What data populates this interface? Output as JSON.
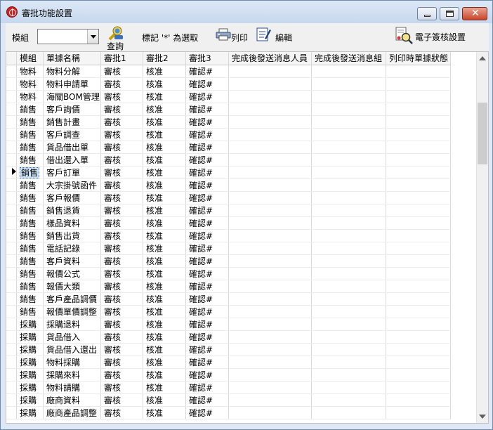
{
  "window": {
    "title": "審批功能設置"
  },
  "toolbar": {
    "module_label": "模組",
    "module_value": "",
    "query_label": "查詢",
    "mark_hint": "標記 '*' 為選取",
    "print_label": "列印",
    "edit_label": "編輯",
    "esign_label": "電子簽核設置"
  },
  "grid": {
    "columns": [
      "模組",
      "單據名稱",
      "審批1",
      "審批2",
      "審批3",
      "完成後發送消息人員",
      "完成後發送消息組",
      "列印時單據狀態"
    ],
    "current_row": 8,
    "rows": [
      [
        "物料",
        "物料分解",
        "審核",
        "核准",
        "確認#",
        "",
        "",
        ""
      ],
      [
        "物料",
        "物料申請單",
        "審核",
        "核准",
        "確認#",
        "",
        "",
        ""
      ],
      [
        "物料",
        "海關BOM管理",
        "審核",
        "核准",
        "確認#",
        "",
        "",
        ""
      ],
      [
        "銷售",
        "客戶詢價",
        "審核",
        "核准",
        "確認#",
        "",
        "",
        ""
      ],
      [
        "銷售",
        "銷售計畫",
        "審核",
        "核准",
        "確認#",
        "",
        "",
        ""
      ],
      [
        "銷售",
        "客戶調查",
        "審核",
        "核准",
        "確認#",
        "",
        "",
        ""
      ],
      [
        "銷售",
        "貨品借出單",
        "審核",
        "核准",
        "確認#",
        "",
        "",
        ""
      ],
      [
        "銷售",
        "借出還入單",
        "審核",
        "核准",
        "確認#",
        "",
        "",
        ""
      ],
      [
        "銷售",
        "客戶訂單",
        "審核",
        "核准",
        "確認#",
        "",
        "",
        ""
      ],
      [
        "銷售",
        "大宗掛號函件",
        "審核",
        "核准",
        "確認#",
        "",
        "",
        ""
      ],
      [
        "銷售",
        "客戶報價",
        "審核",
        "核准",
        "確認#",
        "",
        "",
        ""
      ],
      [
        "銷售",
        "銷售退貨",
        "審核",
        "核准",
        "確認#",
        "",
        "",
        ""
      ],
      [
        "銷售",
        "樣品資料",
        "審核",
        "核准",
        "確認#",
        "",
        "",
        ""
      ],
      [
        "銷售",
        "銷售出貨",
        "審核",
        "核准",
        "確認#",
        "",
        "",
        ""
      ],
      [
        "銷售",
        "電話記錄",
        "審核",
        "核准",
        "確認#",
        "",
        "",
        ""
      ],
      [
        "銷售",
        "客戶資料",
        "審核",
        "核准",
        "確認#",
        "",
        "",
        ""
      ],
      [
        "銷售",
        "報價公式",
        "審核",
        "核准",
        "確認#",
        "",
        "",
        ""
      ],
      [
        "銷售",
        "報價大類",
        "審核",
        "核准",
        "確認#",
        "",
        "",
        ""
      ],
      [
        "銷售",
        "客戶產品調價",
        "審核",
        "核准",
        "確認#",
        "",
        "",
        ""
      ],
      [
        "銷售",
        "報價單價調整",
        "審核",
        "核准",
        "確認#",
        "",
        "",
        ""
      ],
      [
        "採購",
        "採購退料",
        "審核",
        "核准",
        "確認#",
        "",
        "",
        ""
      ],
      [
        "採購",
        "貨品借入",
        "審核",
        "核准",
        "確認#",
        "",
        "",
        ""
      ],
      [
        "採購",
        "貨品借入還出",
        "審核",
        "核准",
        "確認#",
        "",
        "",
        ""
      ],
      [
        "採購",
        "物料採購",
        "審核",
        "核准",
        "確認#",
        "",
        "",
        ""
      ],
      [
        "採購",
        "採購來料",
        "審核",
        "核准",
        "確認#",
        "",
        "",
        ""
      ],
      [
        "採購",
        "物料請購",
        "審核",
        "核准",
        "確認#",
        "",
        "",
        ""
      ],
      [
        "採購",
        "廠商資料",
        "審核",
        "核准",
        "確認#",
        "",
        "",
        ""
      ],
      [
        "採購",
        "廠商產品調整",
        "審核",
        "核准",
        "確認#",
        "",
        "",
        ""
      ]
    ]
  },
  "icons": {
    "query": "magnifier-person-icon",
    "print": "printer-icon",
    "edit": "notepad-pen-icon",
    "esign": "certificate-magnifier-icon"
  }
}
